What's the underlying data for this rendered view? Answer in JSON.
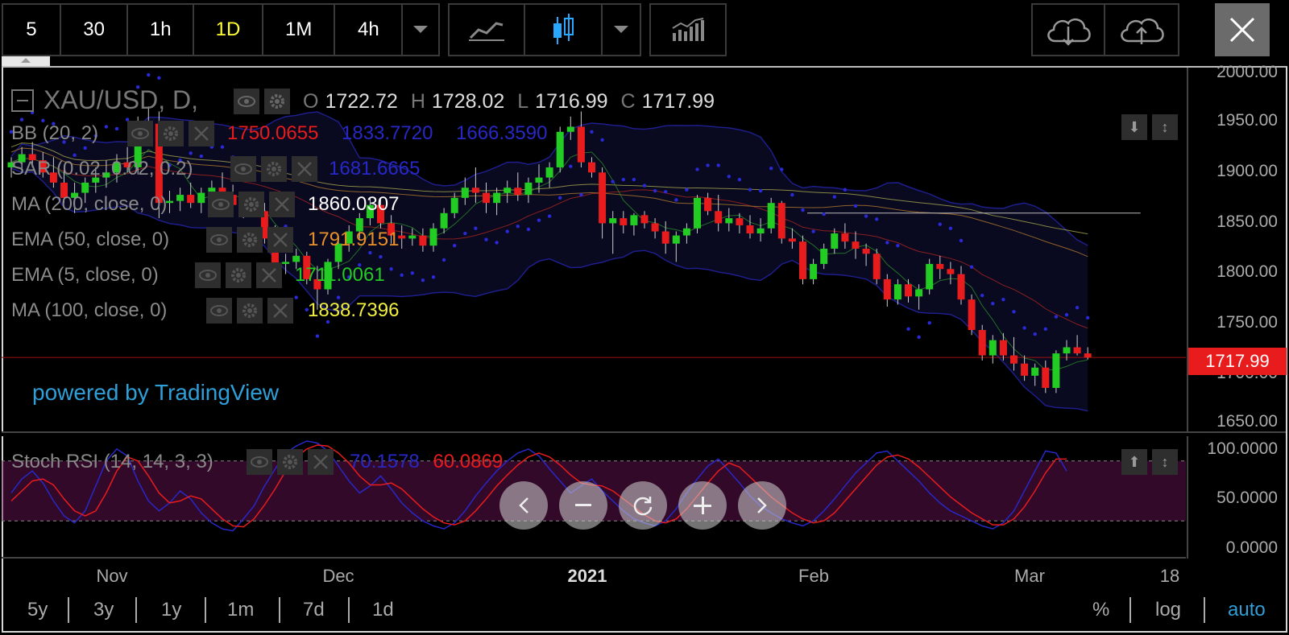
{
  "toolbar": {
    "intervals": [
      "5",
      "30",
      "1h",
      "1D",
      "1M",
      "4h"
    ],
    "active_interval": "1D"
  },
  "chart": {
    "symbol": "XAU/USD, D,",
    "ohlc": {
      "o_key": "O",
      "o": "1722.72",
      "h_key": "H",
      "h": "1728.02",
      "l_key": "L",
      "l": "1716.99",
      "c_key": "C",
      "c": "1717.99"
    },
    "last_price": "1717.99",
    "price_axis": [
      "2000.00",
      "1950.00",
      "1900.00",
      "1850.00",
      "1800.00",
      "1750.00",
      "1700.00",
      "1650.00"
    ],
    "indicators": [
      {
        "name": "BB (20, 2)",
        "values": [
          "1750.0655",
          "1833.7720",
          "1666.3590"
        ],
        "colors": [
          "#e81c1c",
          "#2828c8",
          "#2828c8"
        ]
      },
      {
        "name": "SAR (0.02, 0.02, 0.2)",
        "values": [
          "1681.6665"
        ],
        "colors": [
          "#2828c8"
        ]
      },
      {
        "name": "MA (200, close, 0)",
        "values": [
          "1860.0307"
        ],
        "colors": [
          "#ffffff"
        ]
      },
      {
        "name": "EMA (50, close, 0)",
        "values": [
          "1791.9151"
        ],
        "colors": [
          "#e8902a"
        ]
      },
      {
        "name": "EMA (5, close, 0)",
        "values": [
          "1711.0061"
        ],
        "colors": [
          "#22cc22"
        ]
      },
      {
        "name": "MA (100, close, 0)",
        "values": [
          "1838.7396"
        ],
        "colors": [
          "#f0f040"
        ]
      }
    ],
    "watermark": "powered by TradingView",
    "x_axis": [
      "Nov",
      "Dec",
      "2021",
      "Feb",
      "Mar",
      "18"
    ]
  },
  "stoch": {
    "name": "Stoch RSI (14, 14, 3, 3)",
    "k": "70.1578",
    "d": "60.0869",
    "k_color": "#2828c8",
    "d_color": "#e81c1c",
    "axis": [
      "100.0000",
      "50.0000",
      "0.0000"
    ]
  },
  "ranges": {
    "items": [
      "5y",
      "3y",
      "1y",
      "1m",
      "7d",
      "1d"
    ],
    "scale_items": [
      "%",
      "log",
      "auto"
    ],
    "active_scale": "auto"
  },
  "colors": {
    "up": "#22cc22",
    "down": "#e81c1c",
    "accent": "#2f9fd8",
    "active_interval": "#ffff33"
  },
  "candles": [
    [
      1905,
      1915,
      1895,
      1910
    ],
    [
      1910,
      1925,
      1900,
      1918
    ],
    [
      1918,
      1930,
      1905,
      1912
    ],
    [
      1912,
      1920,
      1895,
      1900
    ],
    [
      1900,
      1915,
      1885,
      1890
    ],
    [
      1890,
      1905,
      1870,
      1875
    ],
    [
      1875,
      1890,
      1860,
      1880
    ],
    [
      1880,
      1895,
      1870,
      1890
    ],
    [
      1890,
      1905,
      1880,
      1895
    ],
    [
      1895,
      1912,
      1885,
      1900
    ],
    [
      1900,
      1918,
      1890,
      1910
    ],
    [
      1910,
      1925,
      1900,
      1905
    ],
    [
      1905,
      1955,
      1898,
      1950
    ],
    [
      1950,
      1965,
      1940,
      1948
    ],
    [
      1948,
      1960,
      1855,
      1870
    ],
    [
      1870,
      1882,
      1860,
      1872
    ],
    [
      1872,
      1885,
      1862,
      1878
    ],
    [
      1878,
      1890,
      1865,
      1870
    ],
    [
      1870,
      1885,
      1860,
      1880
    ],
    [
      1880,
      1892,
      1870,
      1885
    ],
    [
      1885,
      1900,
      1875,
      1878
    ],
    [
      1878,
      1888,
      1860,
      1868
    ],
    [
      1868,
      1880,
      1855,
      1872
    ],
    [
      1872,
      1880,
      1858,
      1862
    ],
    [
      1862,
      1870,
      1830,
      1835
    ],
    [
      1835,
      1848,
      1805,
      1810
    ],
    [
      1810,
      1820,
      1800,
      1812
    ],
    [
      1812,
      1825,
      1805,
      1818
    ],
    [
      1818,
      1822,
      1790,
      1795
    ],
    [
      1795,
      1808,
      1765,
      1785
    ],
    [
      1785,
      1815,
      1780,
      1812
    ],
    [
      1812,
      1835,
      1805,
      1830
    ],
    [
      1830,
      1848,
      1822,
      1842
    ],
    [
      1842,
      1860,
      1835,
      1855
    ],
    [
      1855,
      1875,
      1848,
      1868
    ],
    [
      1868,
      1875,
      1845,
      1850
    ],
    [
      1850,
      1858,
      1830,
      1838
    ],
    [
      1838,
      1848,
      1825,
      1835
    ],
    [
      1835,
      1845,
      1828,
      1838
    ],
    [
      1838,
      1845,
      1822,
      1828
    ],
    [
      1828,
      1850,
      1822,
      1845
    ],
    [
      1845,
      1865,
      1840,
      1860
    ],
    [
      1860,
      1880,
      1855,
      1875
    ],
    [
      1875,
      1895,
      1868,
      1885
    ],
    [
      1885,
      1905,
      1870,
      1880
    ],
    [
      1880,
      1890,
      1860,
      1870
    ],
    [
      1870,
      1885,
      1858,
      1880
    ],
    [
      1880,
      1892,
      1870,
      1885
    ],
    [
      1885,
      1900,
      1872,
      1878
    ],
    [
      1878,
      1895,
      1870,
      1890
    ],
    [
      1890,
      1908,
      1880,
      1895
    ],
    [
      1895,
      1910,
      1885,
      1905
    ],
    [
      1905,
      1945,
      1900,
      1940
    ],
    [
      1940,
      1955,
      1932,
      1945
    ],
    [
      1945,
      1960,
      1905,
      1910
    ],
    [
      1910,
      1915,
      1895,
      1900
    ],
    [
      1900,
      1905,
      1835,
      1850
    ],
    [
      1850,
      1862,
      1820,
      1855
    ],
    [
      1855,
      1862,
      1840,
      1848
    ],
    [
      1848,
      1860,
      1838,
      1858
    ],
    [
      1858,
      1862,
      1845,
      1850
    ],
    [
      1850,
      1855,
      1835,
      1842
    ],
    [
      1842,
      1852,
      1820,
      1830
    ],
    [
      1830,
      1842,
      1812,
      1838
    ],
    [
      1838,
      1850,
      1830,
      1845
    ],
    [
      1845,
      1878,
      1840,
      1875
    ],
    [
      1875,
      1880,
      1858,
      1862
    ],
    [
      1862,
      1878,
      1842,
      1850
    ],
    [
      1850,
      1865,
      1842,
      1855
    ],
    [
      1855,
      1860,
      1840,
      1848
    ],
    [
      1848,
      1858,
      1835,
      1840
    ],
    [
      1840,
      1855,
      1832,
      1845
    ],
    [
      1845,
      1875,
      1840,
      1870
    ],
    [
      1870,
      1872,
      1830,
      1835
    ],
    [
      1835,
      1845,
      1825,
      1832
    ],
    [
      1832,
      1838,
      1790,
      1795
    ],
    [
      1795,
      1815,
      1790,
      1810
    ],
    [
      1810,
      1830,
      1805,
      1825
    ],
    [
      1825,
      1845,
      1820,
      1840
    ],
    [
      1840,
      1850,
      1825,
      1832
    ],
    [
      1832,
      1842,
      1815,
      1825
    ],
    [
      1825,
      1830,
      1808,
      1820
    ],
    [
      1820,
      1825,
      1790,
      1795
    ],
    [
      1795,
      1800,
      1768,
      1775
    ],
    [
      1775,
      1795,
      1770,
      1790
    ],
    [
      1790,
      1795,
      1772,
      1778
    ],
    [
      1778,
      1790,
      1765,
      1785
    ],
    [
      1785,
      1815,
      1780,
      1810
    ],
    [
      1810,
      1818,
      1795,
      1805
    ],
    [
      1805,
      1812,
      1790,
      1800
    ],
    [
      1800,
      1808,
      1770,
      1775
    ],
    [
      1775,
      1780,
      1740,
      1745
    ],
    [
      1745,
      1750,
      1715,
      1720
    ],
    [
      1720,
      1740,
      1712,
      1735
    ],
    [
      1735,
      1742,
      1715,
      1720
    ],
    [
      1720,
      1738,
      1705,
      1712
    ],
    [
      1712,
      1720,
      1695,
      1700
    ],
    [
      1700,
      1712,
      1690,
      1708
    ],
    [
      1708,
      1715,
      1683,
      1688
    ],
    [
      1688,
      1725,
      1683,
      1722
    ],
    [
      1722,
      1735,
      1715,
      1728
    ],
    [
      1728,
      1740,
      1720,
      1722
    ],
    [
      1722,
      1728,
      1716,
      1718
    ]
  ],
  "stoch_k": [
    48,
    62,
    70,
    58,
    40,
    25,
    18,
    30,
    55,
    80,
    92,
    85,
    60,
    40,
    30,
    38,
    50,
    42,
    28,
    18,
    12,
    10,
    22,
    35,
    55,
    72,
    88,
    95,
    100,
    98,
    90,
    75,
    60,
    48,
    55,
    65,
    52,
    38,
    28,
    20,
    15,
    12,
    18,
    30,
    45,
    58,
    70,
    80,
    88,
    92,
    85,
    72,
    60,
    48,
    55,
    62,
    50,
    40,
    30,
    22,
    18,
    15,
    20,
    32,
    48,
    62,
    75,
    82,
    70,
    58,
    45,
    35,
    28,
    22,
    18,
    15,
    20,
    30,
    42,
    55,
    68,
    78,
    88,
    90,
    80,
    70,
    60,
    48,
    38,
    30,
    25,
    20,
    15,
    12,
    18,
    30,
    50,
    70,
    90,
    88,
    70
  ],
  "stoch_d": [
    40,
    50,
    60,
    62,
    56,
    42,
    30,
    25,
    30,
    48,
    70,
    84,
    80,
    65,
    48,
    38,
    40,
    45,
    42,
    32,
    22,
    15,
    14,
    22,
    36,
    52,
    70,
    84,
    92,
    96,
    95,
    88,
    78,
    65,
    56,
    56,
    58,
    52,
    42,
    32,
    24,
    18,
    16,
    20,
    30,
    42,
    55,
    66,
    76,
    84,
    88,
    84,
    76,
    66,
    58,
    56,
    55,
    50,
    42,
    34,
    26,
    20,
    18,
    22,
    32,
    45,
    58,
    70,
    78,
    74,
    64,
    54,
    44,
    36,
    28,
    22,
    18,
    20,
    28,
    40,
    52,
    64,
    76,
    84,
    86,
    82,
    74,
    64,
    54,
    44,
    36,
    28,
    22,
    16,
    16,
    22,
    34,
    50,
    68,
    82,
    82
  ]
}
